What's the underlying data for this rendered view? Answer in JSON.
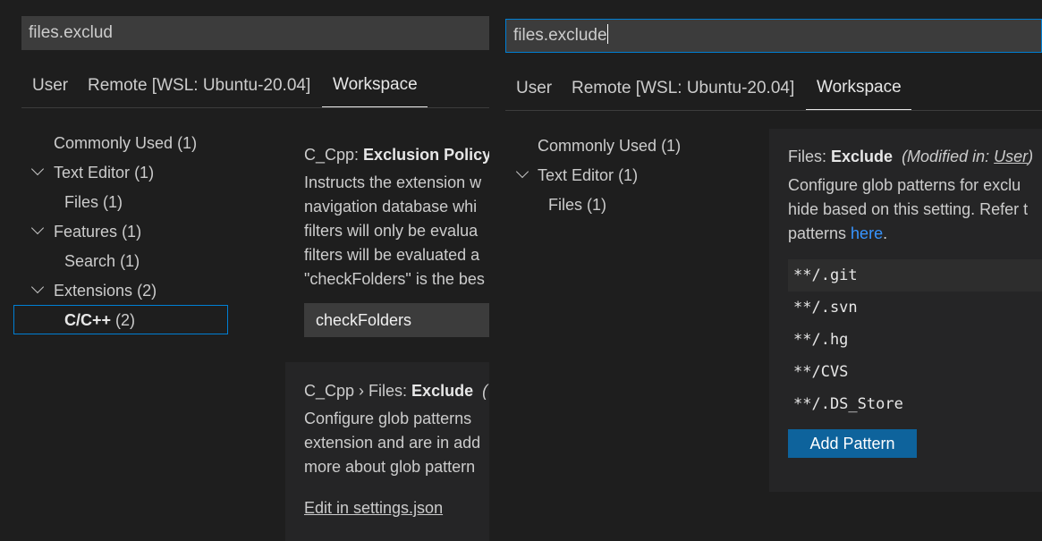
{
  "left": {
    "search": {
      "value": "files.exclud"
    },
    "tabs": [
      {
        "label": "User"
      },
      {
        "label": "Remote [WSL: Ubuntu-20.04]"
      },
      {
        "label": "Workspace"
      }
    ],
    "toc": [
      {
        "label": "Commonly Used",
        "count": "(1)"
      },
      {
        "label": "Text Editor",
        "count": "(1)"
      },
      {
        "label": "Files",
        "count": "(1)"
      },
      {
        "label": "Features",
        "count": "(1)"
      },
      {
        "label": "Search",
        "count": "(1)"
      },
      {
        "label": "Extensions",
        "count": "(2)"
      },
      {
        "label": "C/C++",
        "count": "(2)"
      }
    ],
    "setting1": {
      "prefix": "C_Cpp: ",
      "name": "Exclusion Policy",
      "desc": [
        "Instructs the extension w",
        "navigation database whi",
        "filters will only be evalua",
        "filters will be evaluated a",
        "\"checkFolders\" is the bes"
      ],
      "dropdown_value": "checkFolders"
    },
    "setting2": {
      "prefix": "C_Cpp › Files: ",
      "name": "Exclude",
      "suffix": "(",
      "desc": [
        "Configure glob patterns",
        "extension and are in add",
        "more about glob pattern"
      ],
      "edit_link": "Edit in settings.json"
    }
  },
  "right": {
    "search": {
      "value": "files.exclude"
    },
    "tabs": [
      {
        "label": "User"
      },
      {
        "label": "Remote [WSL: Ubuntu-20.04]"
      },
      {
        "label": "Workspace"
      }
    ],
    "toc": [
      {
        "label": "Commonly Used",
        "count": "(1)"
      },
      {
        "label": "Text Editor",
        "count": "(1)"
      },
      {
        "label": "Files",
        "count": "(1)"
      }
    ],
    "setting": {
      "prefix": "Files: ",
      "name": "Exclude",
      "modified_prefix": "(Modified in: ",
      "modified_scope": "User",
      "modified_suffix": ")",
      "desc_line1": "Configure glob patterns for exclu",
      "desc_line2": "hide based on this setting. Refer t",
      "desc_line3_prefix": "patterns ",
      "desc_line3_link": "here",
      "desc_line3_suffix": ".",
      "patterns": [
        "**/.git",
        "**/.svn",
        "**/.hg",
        "**/CVS",
        "**/.DS_Store"
      ],
      "add_button": "Add Pattern"
    }
  },
  "colors": {
    "background": "#1e1e1e",
    "input": "#3c3c3c",
    "focus_border": "#007fd4",
    "link": "#3794ff",
    "button": "#0e639c"
  }
}
